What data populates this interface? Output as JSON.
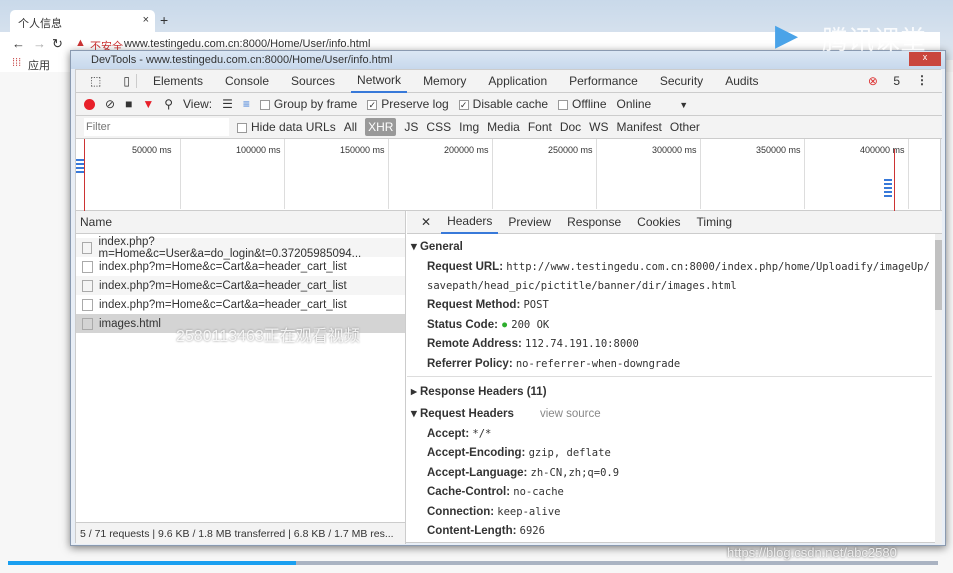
{
  "browser": {
    "tab_title": "个人信息",
    "insecure_label": "不安全",
    "url": "www.testingedu.com.cn:8000/Home/User/info.html",
    "bookmark_apps": "应用"
  },
  "devtools": {
    "title": "DevTools - www.testingedu.com.cn:8000/Home/User/info.html",
    "tabs": [
      "Elements",
      "Console",
      "Sources",
      "Network",
      "Memory",
      "Application",
      "Performance",
      "Security",
      "Audits"
    ],
    "active_tab": "Network",
    "error_count": "5",
    "toolbar": {
      "view_label": "View:",
      "group_by_frame": "Group by frame",
      "preserve_log": "Preserve log",
      "disable_cache": "Disable cache",
      "offline": "Offline",
      "throttle": "Online",
      "preserve_log_checked": true,
      "disable_cache_checked": true
    },
    "filter": {
      "placeholder": "Filter",
      "hide_data_urls": "Hide data URLs",
      "types": [
        "All",
        "XHR",
        "JS",
        "CSS",
        "Img",
        "Media",
        "Font",
        "Doc",
        "WS",
        "Manifest",
        "Other"
      ],
      "active_type": "XHR"
    },
    "timeline_ticks": [
      "50000 ms",
      "100000 ms",
      "150000 ms",
      "200000 ms",
      "250000 ms",
      "300000 ms",
      "350000 ms",
      "400000 ms"
    ],
    "requests": {
      "header": "Name",
      "items": [
        "index.php?m=Home&c=User&a=do_login&t=0.37205985094...",
        "index.php?m=Home&c=Cart&a=header_cart_list",
        "index.php?m=Home&c=Cart&a=header_cart_list",
        "index.php?m=Home&c=Cart&a=header_cart_list",
        "images.html"
      ],
      "selected": 4
    },
    "status_bar": "5 / 71 requests | 9.6 KB / 1.8 MB transferred | 6.8 KB / 1.7 MB res...",
    "detail": {
      "tabs": [
        "Headers",
        "Preview",
        "Response",
        "Cookies",
        "Timing"
      ],
      "active": "Headers",
      "general_title": "General",
      "general": [
        {
          "k": "Request URL:",
          "v": "http://www.testingedu.com.cn:8000/index.php/home/Uploadify/imageUp/savepath/head_pic/pictitle/banner/dir/images.html"
        },
        {
          "k": "Request Method:",
          "v": "POST"
        },
        {
          "k": "Status Code:",
          "v": "200 OK"
        },
        {
          "k": "Remote Address:",
          "v": "112.74.191.10:8000"
        },
        {
          "k": "Referrer Policy:",
          "v": "no-referrer-when-downgrade"
        }
      ],
      "response_headers_title": "Response Headers (11)",
      "request_headers_title": "Request Headers",
      "view_source": "view source",
      "request_headers": [
        {
          "k": "Accept:",
          "v": "*/*"
        },
        {
          "k": "Accept-Encoding:",
          "v": "gzip, deflate"
        },
        {
          "k": "Accept-Language:",
          "v": "zh-CN,zh;q=0.9"
        },
        {
          "k": "Cache-Control:",
          "v": "no-cache"
        },
        {
          "k": "Connection:",
          "v": "keep-alive"
        },
        {
          "k": "Content-Length:",
          "v": "6926"
        }
      ]
    }
  },
  "overlay": {
    "watermark_brand": "腾讯课堂",
    "viewer_notice": "2580113463正在观看视频",
    "blog_watermark": "https://blog.csdn.net/abc2580",
    "video_progress": 0.31
  },
  "colors": {
    "accent": "#3879d9",
    "record": "#e8202a",
    "status_ok": "#2eae2e"
  }
}
